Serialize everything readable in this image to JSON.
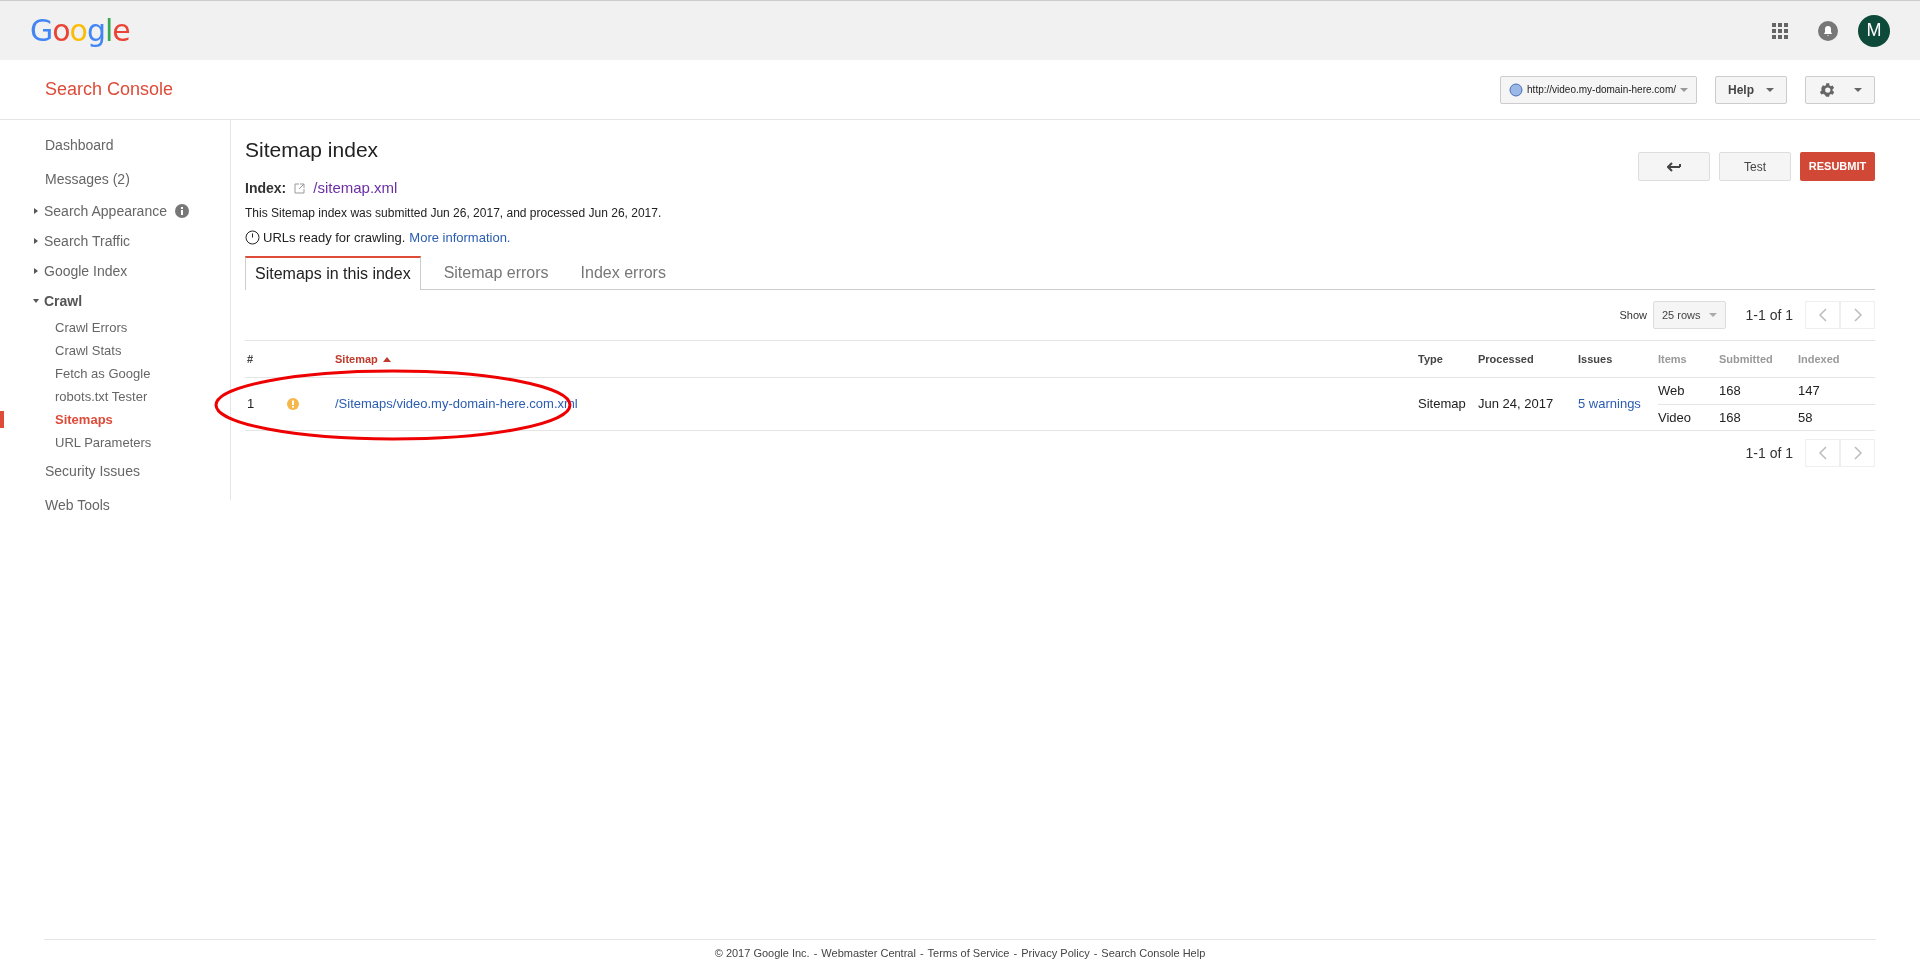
{
  "header": {
    "logo": "Google",
    "avatar_letter": "M"
  },
  "subheader": {
    "title": "Search Console",
    "property": "http://video.my-domain-here.com/",
    "help": "Help"
  },
  "sidebar": {
    "items": [
      {
        "label": "Dashboard",
        "kind": "link",
        "selected": false
      },
      {
        "label": "Messages (2)",
        "kind": "link",
        "selected": false
      },
      {
        "label": "Search Appearance",
        "kind": "group",
        "expanded": false,
        "info": true,
        "selected": false
      },
      {
        "label": "Search Traffic",
        "kind": "group",
        "expanded": false,
        "info": false,
        "selected": false
      },
      {
        "label": "Google Index",
        "kind": "group",
        "expanded": false,
        "info": false,
        "selected": false
      },
      {
        "label": "Crawl",
        "kind": "group",
        "expanded": true,
        "info": false,
        "selected": false,
        "children": [
          {
            "label": "Crawl Errors",
            "selected": false
          },
          {
            "label": "Crawl Stats",
            "selected": false
          },
          {
            "label": "Fetch as Google",
            "selected": false
          },
          {
            "label": "robots.txt Tester",
            "selected": false
          },
          {
            "label": "Sitemaps",
            "selected": true
          },
          {
            "label": "URL Parameters",
            "selected": false
          }
        ]
      },
      {
        "label": "Security Issues",
        "kind": "link",
        "selected": false
      },
      {
        "label": "Web Tools",
        "kind": "link",
        "selected": false
      }
    ]
  },
  "page": {
    "title": "Sitemap index",
    "buttons": {
      "test": "Test",
      "resubmit": "RESUBMIT"
    },
    "index_label": "Index:",
    "index_link": "/sitemap.xml",
    "info_line": "This Sitemap index was submitted Jun 26, 2017, and processed Jun 26, 2017.",
    "status_text": "URLs ready for crawling.",
    "status_link": "More information.",
    "tabs": [
      {
        "label": "Sitemaps in this index",
        "selected": true
      },
      {
        "label": "Sitemap errors",
        "selected": false
      },
      {
        "label": "Index errors",
        "selected": false
      }
    ]
  },
  "table": {
    "show_label": "Show",
    "rows_select": "25 rows",
    "pagination_top": "1-1 of 1",
    "pagination_bottom": "1-1 of 1",
    "columns": [
      {
        "label": "#",
        "sorted": false
      },
      {
        "label": "Sitemap",
        "sorted": true
      },
      {
        "label": "Type",
        "sorted": false
      },
      {
        "label": "Processed",
        "sorted": false
      },
      {
        "label": "Issues",
        "sorted": false
      },
      {
        "label": "Items",
        "sorted": false
      },
      {
        "label": "Submitted",
        "sorted": false
      },
      {
        "label": "Indexed",
        "sorted": false
      }
    ],
    "rows": [
      {
        "number": "1",
        "warning": true,
        "sitemap": "/Sitemaps/video.my-domain-here.com.xml",
        "type": "Sitemap",
        "processed": "Jun 24, 2017",
        "issues": "5 warnings",
        "items": [
          {
            "item": "Web",
            "submitted": "168",
            "indexed": "147"
          },
          {
            "item": "Video",
            "submitted": "168",
            "indexed": "58"
          }
        ]
      }
    ]
  },
  "footer": {
    "parts": [
      {
        "kind": "text",
        "text": "© 2017 Google Inc."
      },
      {
        "kind": "separator",
        "text": "-"
      },
      {
        "kind": "link",
        "text": "Webmaster Central"
      },
      {
        "kind": "separator",
        "text": "-"
      },
      {
        "kind": "link",
        "text": "Terms of Service"
      },
      {
        "kind": "separator",
        "text": "-"
      },
      {
        "kind": "link",
        "text": "Privacy Policy"
      },
      {
        "kind": "separator",
        "text": "-"
      },
      {
        "kind": "link",
        "text": "Search Console Help"
      }
    ]
  }
}
